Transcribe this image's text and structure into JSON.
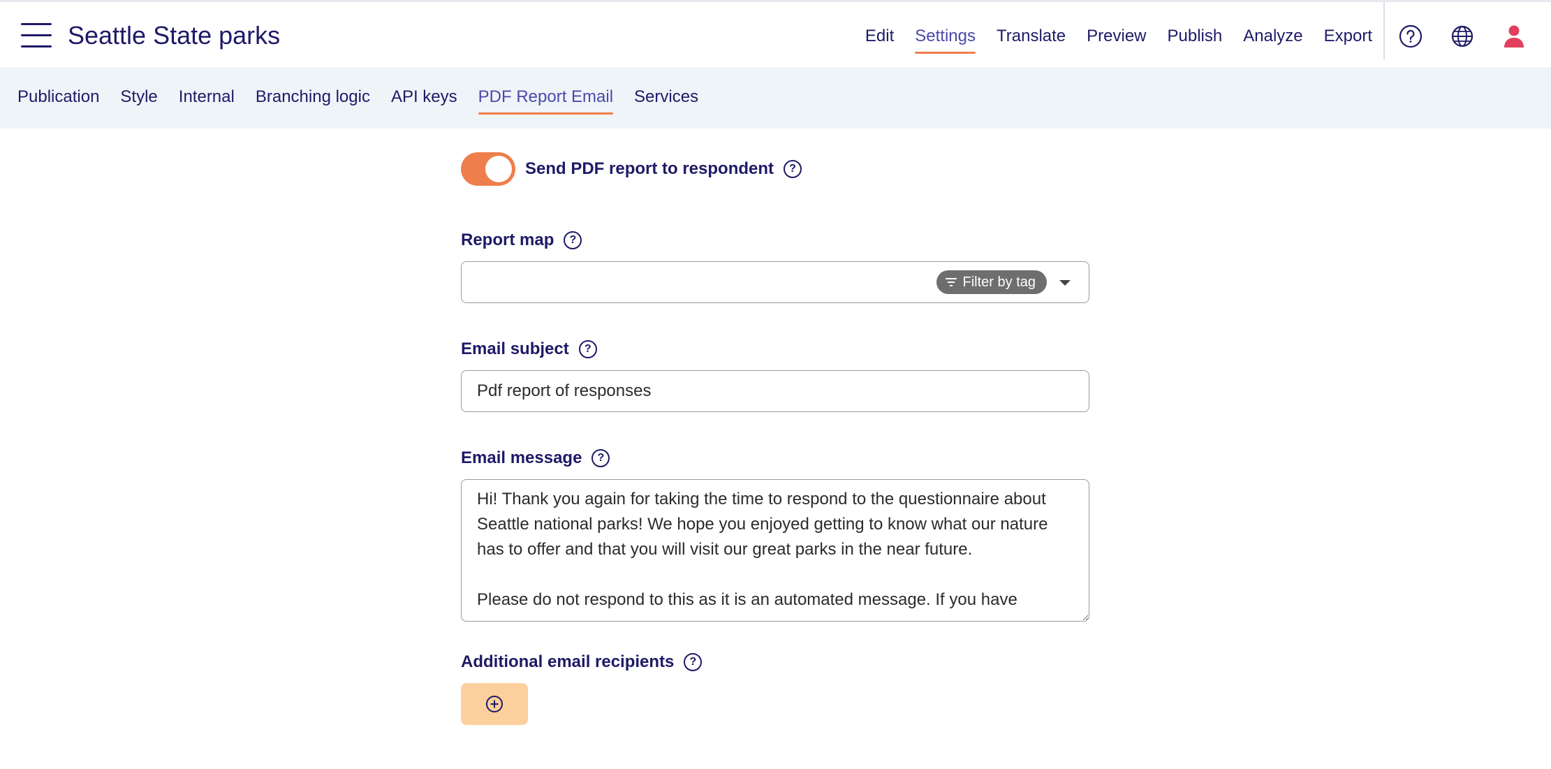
{
  "header": {
    "title": "Seattle State parks",
    "nav": [
      "Edit",
      "Settings",
      "Translate",
      "Preview",
      "Publish",
      "Analyze",
      "Export"
    ],
    "active_nav": "Settings",
    "icons": [
      "help-circle-icon",
      "globe-icon",
      "user-icon"
    ]
  },
  "subnav": {
    "tabs": [
      "Publication",
      "Style",
      "Internal",
      "Branching logic",
      "API keys",
      "PDF Report Email",
      "Services"
    ],
    "active_tab": "PDF Report Email"
  },
  "form": {
    "toggle": {
      "label": "Send PDF report to respondent",
      "on": true
    },
    "report_map": {
      "label": "Report map",
      "value": "",
      "filter_label": "Filter by tag"
    },
    "email_subject": {
      "label": "Email subject",
      "value": "Pdf report of responses"
    },
    "email_message": {
      "label": "Email message",
      "value": "Hi! Thank you again for taking the time to respond to the questionnaire about Seattle national parks! We hope you enjoyed getting to know what our nature has to offer and that you will visit our great parks in the near future.\n\nPlease do not respond to this as it is an automated message. If you have"
    },
    "additional_recipients": {
      "label": "Additional email recipients"
    }
  },
  "colors": {
    "primary_text": "#1f1a66",
    "accent": "#ee7e4b",
    "subnav_bg": "#eff4f9",
    "add_button_bg": "#fbd09d",
    "chip_bg": "#6e6e6e",
    "user_icon": "#e0405e"
  }
}
